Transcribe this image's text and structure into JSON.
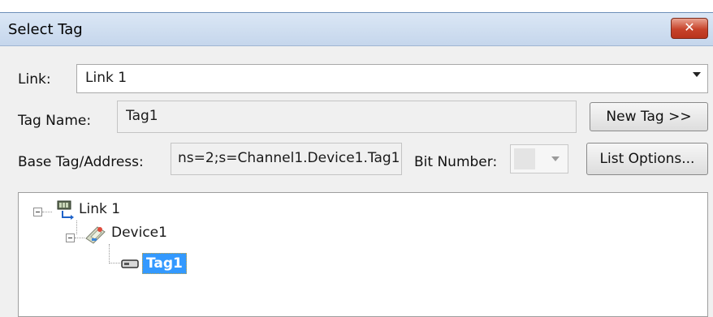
{
  "window": {
    "title": "Select Tag",
    "close_label": "✕"
  },
  "form": {
    "link_label": "Link:",
    "link_value": "Link 1",
    "tag_name_label": "Tag Name:",
    "tag_name_value": "Tag1",
    "new_tag_button": "New Tag >>",
    "base_tag_label": "Base Tag/Address:",
    "base_tag_value": "ns=2;s=Channel1.Device1.Tag1",
    "bit_number_label": "Bit Number:",
    "bit_number_value": "",
    "list_options_button": "List Options..."
  },
  "tree": {
    "items": [
      {
        "label": "Link 1",
        "icon": "link-icon",
        "expanded": true
      },
      {
        "label": "Device1",
        "icon": "device-icon",
        "expanded": true
      },
      {
        "label": "Tag1",
        "icon": "tag-icon",
        "selected": true
      }
    ]
  },
  "colors": {
    "selection": "#3399ff",
    "title_bar": "#c5d6ec",
    "close_button": "#c7432a"
  }
}
